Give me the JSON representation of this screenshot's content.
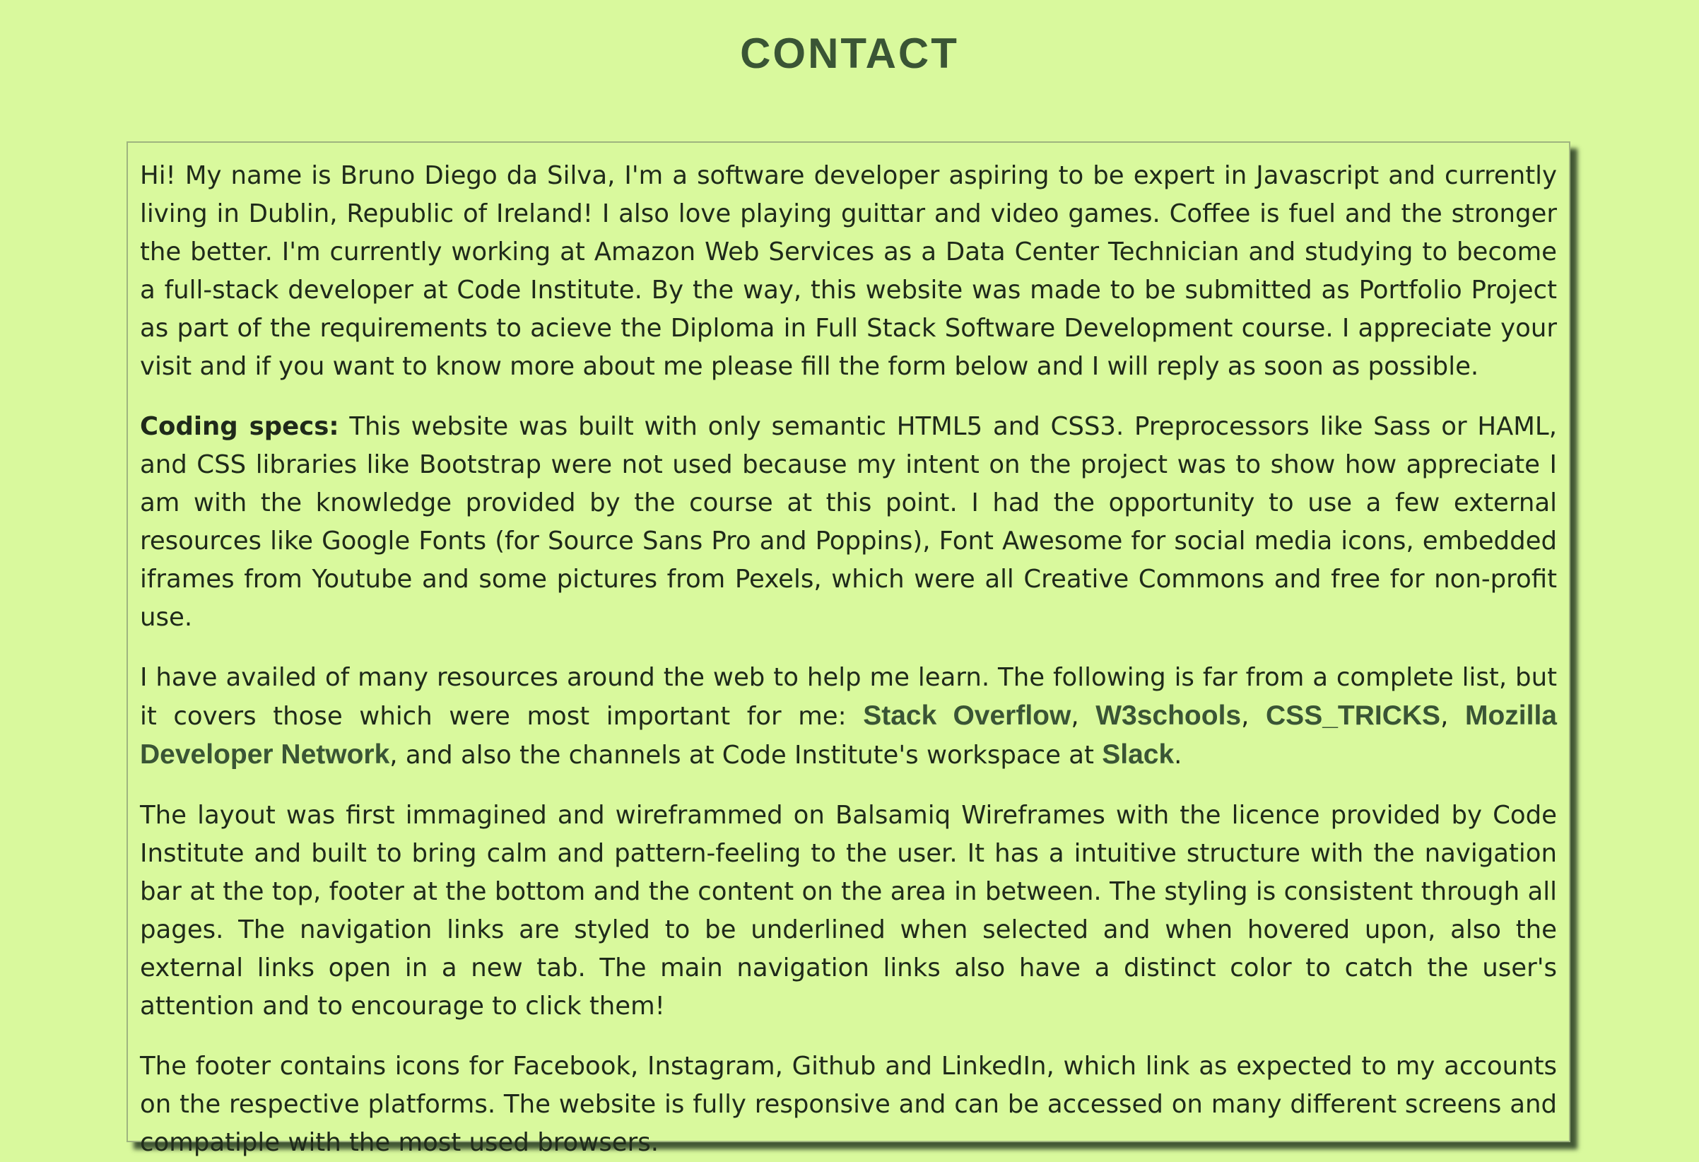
{
  "page": {
    "title": "CONTACT"
  },
  "about": {
    "intro": "Hi! My name is Bruno Diego da Silva, I'm a software developer aspiring to be expert in Javascript and currently living in Dublin, Republic of Ireland! I also love playing guittar and video games. Coffee is fuel and the stronger the better. I'm currently working at Amazon Web Services as a Data Center Technician and studying to become a full-stack developer at Code Institute. By the way, this website was made to be submitted as Portfolio Project as part of the requirements to acieve the Diploma in Full Stack Software Development course. I appreciate your visit and if you want to know more about me please fill the form below and I will reply as soon as possible.",
    "coding_specs_label": "Coding specs:",
    "coding_specs_text": " This website was built with only semantic HTML5 and CSS3. Preprocessors like Sass or HAML, and CSS libraries like Bootstrap were not used because my intent on the project was to show how appreciate I am with the knowledge provided by the course at this point. I had the opportunity to use a few external resources like Google Fonts (for Source Sans Pro and Poppins), Font Awesome for social media icons, embedded iframes from Youtube and some pictures from Pexels, which were all Creative Commons and free for non-profit use.",
    "resources_text_1": "I have availed of many resources around the web to help me learn. The following is far from a complete list, but it covers those which were most important for me: ",
    "sep_1": ", ",
    "sep_2": ", ",
    "sep_3": ", ",
    "resources_text_2": ", and also the channels at Code Institute's workspace at ",
    "resources_end": ".",
    "links": {
      "stack_overflow": "Stack Overflow",
      "w3schools": "W3schools",
      "css_tricks": "CSS_TRICKS",
      "mdn": "Mozilla Developer Network",
      "slack": "Slack"
    },
    "layout_text": "The layout was first immagined and wireframmed on Balsamiq Wireframes with the licence provided by Code Institute and built to bring calm and pattern-feeling to the user. It has a intuitive structure with the navigation bar at the top, footer at the bottom and the content on the area in between. The styling is consistent through all pages. The navigation links are styled to be underlined when selected and when hovered upon, also the external links open in a new tab. The main navigation links also have a distinct color to catch the user's attention and to encourage to click them!",
    "footer_text": "The footer contains icons for Facebook, Instagram, Github and LinkedIn, which link as expected to my accounts on the respective platforms. The website is fully responsive and can be accessed on many different screens and compatiple with the most used browsers."
  },
  "colors": {
    "background": "#d9f99d",
    "heading": "#3a5535",
    "text": "#1f2a1a",
    "shadow": "#2f4a2a"
  }
}
